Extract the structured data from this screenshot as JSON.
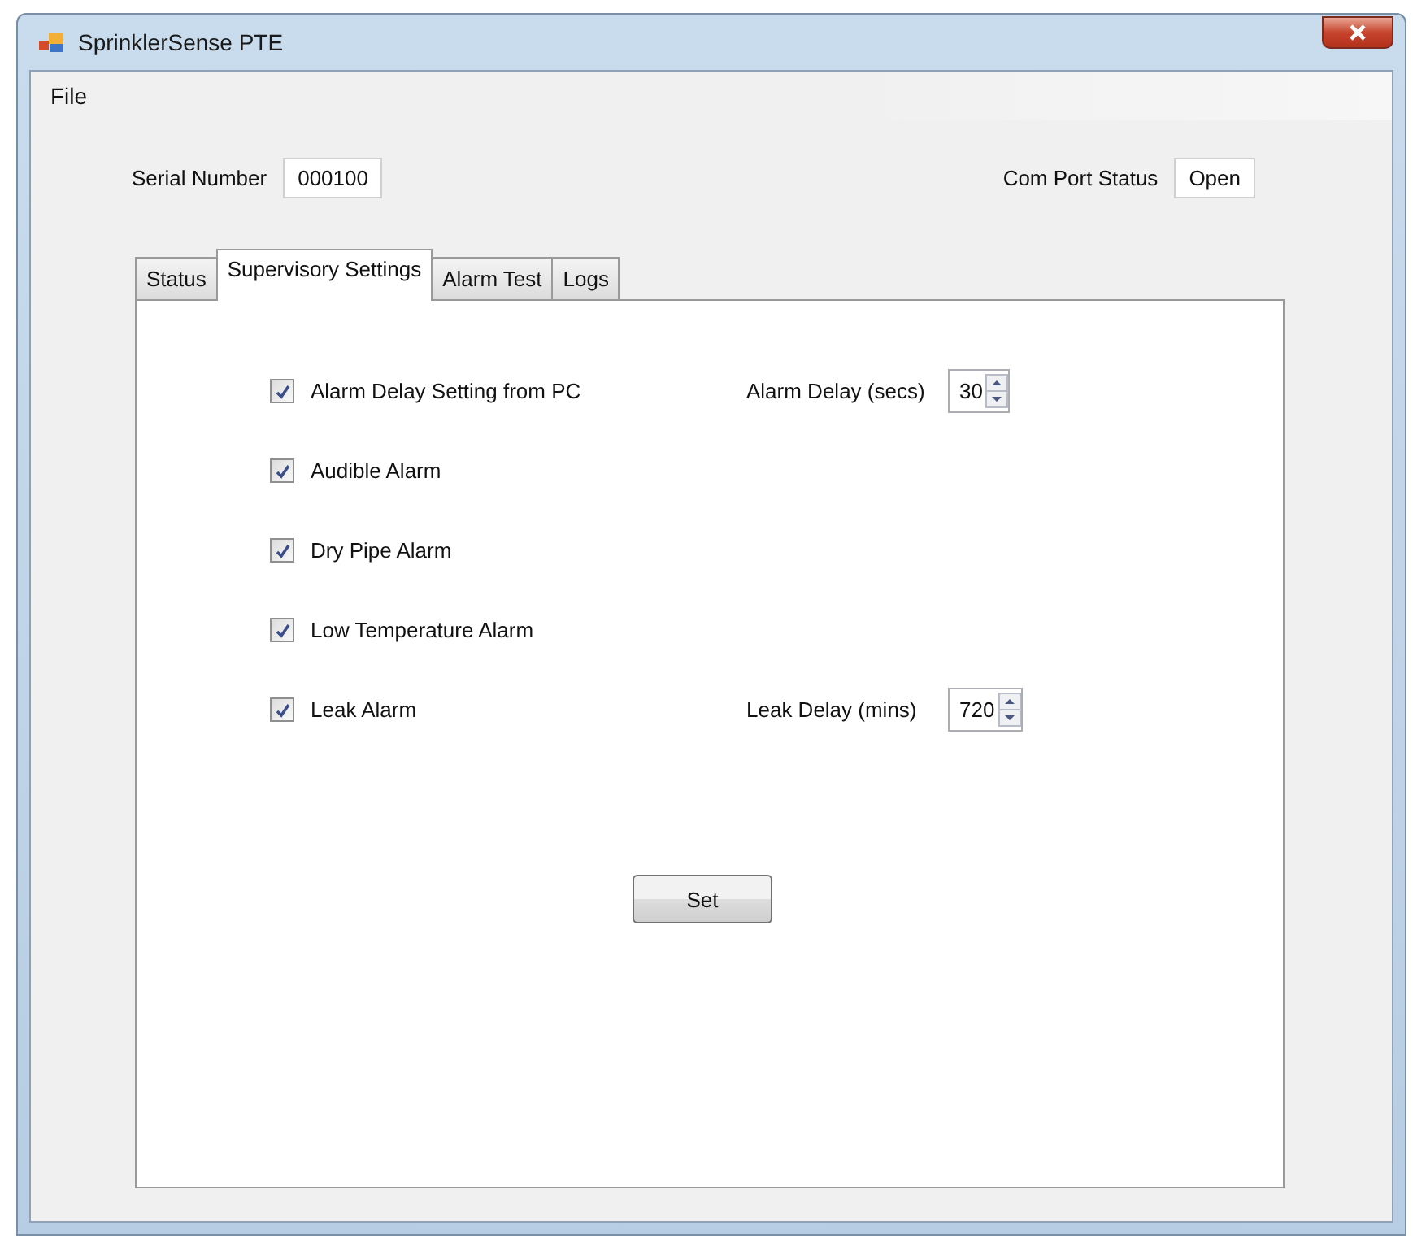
{
  "window": {
    "title": "SprinklerSense PTE"
  },
  "menu": [
    "File"
  ],
  "serial_number": {
    "label": "Serial Number",
    "value": "000100"
  },
  "com_port_status": {
    "label": "Com Port Status",
    "value": "Open"
  },
  "tabs": [
    {
      "label": "Status",
      "selected": false
    },
    {
      "label": "Supervisory Settings",
      "selected": true
    },
    {
      "label": "Alarm Test",
      "selected": false
    },
    {
      "label": "Logs",
      "selected": false
    }
  ],
  "settings": [
    {
      "label": "Alarm Delay Setting from PC",
      "checked": true,
      "spinner": {
        "label": "Alarm Delay (secs)",
        "value": "30"
      }
    },
    {
      "label": "Audible Alarm",
      "checked": true
    },
    {
      "label": "Dry Pipe Alarm",
      "checked": true
    },
    {
      "label": "Low Temperature Alarm",
      "checked": true
    },
    {
      "label": "Leak Alarm",
      "checked": true,
      "spinner": {
        "label": "Leak Delay (mins)",
        "value": "720"
      }
    }
  ],
  "set_button": "Set"
}
